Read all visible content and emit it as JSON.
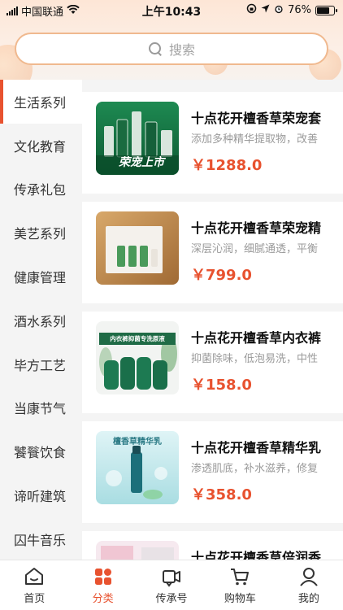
{
  "status_bar": {
    "carrier": "中国联通",
    "time": "上午10:43",
    "battery": "76%",
    "battery_level": 0.76
  },
  "search": {
    "placeholder": "搜索"
  },
  "sidebar": {
    "items": [
      {
        "label": "生活系列"
      },
      {
        "label": "文化教育"
      },
      {
        "label": "传承礼包"
      },
      {
        "label": "美艺系列"
      },
      {
        "label": "健康管理"
      },
      {
        "label": "酒水系列"
      },
      {
        "label": "毕方工艺"
      },
      {
        "label": "当康节气"
      },
      {
        "label": "饕餮饮食"
      },
      {
        "label": "谛听建筑"
      },
      {
        "label": "囚牛音乐"
      }
    ]
  },
  "products": [
    {
      "title": "十点花开檀香草荣宠套",
      "desc": "添加多种精华提取物，改善",
      "price": "￥1288.0",
      "thumb_text": "荣宠上市"
    },
    {
      "title": "十点花开檀香草荣宠精",
      "desc": "深层沁润，细腻通透，平衡",
      "price": "￥799.0"
    },
    {
      "title": "十点花开檀香草内衣裤",
      "desc": "抑菌除味，低泡易洗，中性",
      "price": "￥158.0",
      "thumb_text": "内衣裤抑菌专洗原液"
    },
    {
      "title": "十点花开檀香草精华乳",
      "desc": "渗透肌底，补水滋养，修复",
      "price": "￥358.0",
      "thumb_text": "檀香草精华乳"
    },
    {
      "title": "十点花开檀香草倍润香",
      "desc": "",
      "price": ""
    }
  ],
  "tabbar": {
    "items": [
      {
        "label": "首页"
      },
      {
        "label": "分类"
      },
      {
        "label": "传承号"
      },
      {
        "label": "购物车"
      },
      {
        "label": "我的"
      }
    ]
  },
  "colors": {
    "accent": "#e8522f",
    "search_border": "#f0b98f"
  }
}
